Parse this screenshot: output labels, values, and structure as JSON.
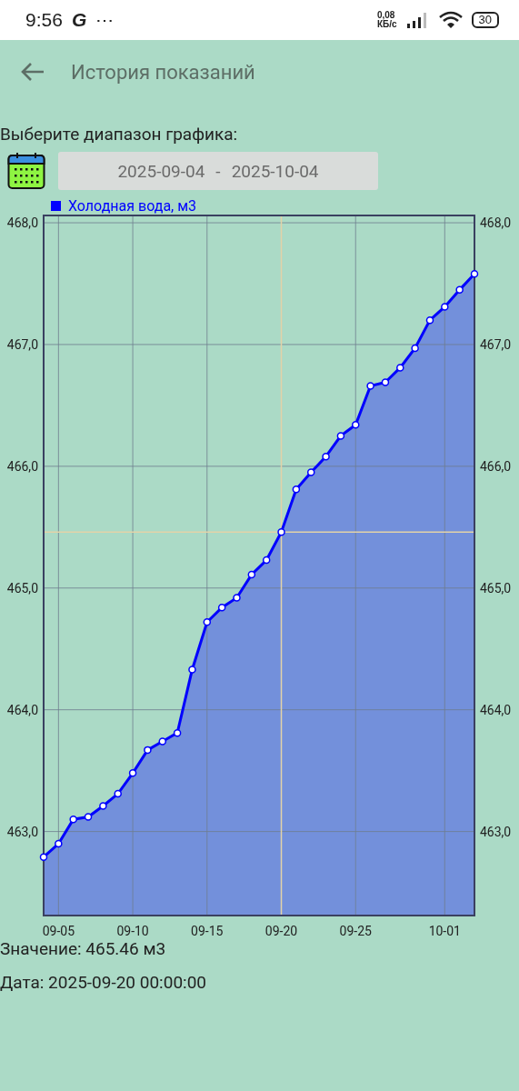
{
  "status_bar": {
    "time": "9:56",
    "carrier": "G",
    "more": "⋯",
    "speed_value": "0,08",
    "speed_unit": "КБ/с",
    "battery": "30"
  },
  "app_bar": {
    "title": "История показаний"
  },
  "range": {
    "label": "Выберите диапазон графика:",
    "start": "2025-09-04",
    "separator": "-",
    "end": "2025-10-04"
  },
  "chart": {
    "chart_data": {
      "type": "area",
      "categories": [
        null,
        "09-05",
        null,
        null,
        null,
        null,
        "09-10",
        null,
        null,
        null,
        null,
        "09-15",
        null,
        null,
        null,
        null,
        "09-20",
        null,
        null,
        null,
        null,
        "09-25",
        null,
        null,
        null,
        null,
        null,
        "10-01",
        null,
        null
      ],
      "grid": true,
      "series": [
        {
          "name": "Холодная вода, м3",
          "color": "#0000ff",
          "values": [
            462.79,
            462.9,
            463.1,
            463.12,
            463.21,
            463.31,
            463.48,
            463.67,
            463.74,
            463.81,
            464.33,
            464.72,
            464.84,
            464.92,
            465.11,
            465.23,
            465.46,
            465.81,
            465.95,
            466.08,
            466.25,
            466.34,
            466.66,
            466.69,
            466.81,
            466.97,
            467.2,
            467.31,
            467.45,
            467.58
          ]
        }
      ],
      "ylim": [
        462.31,
        468.06
      ],
      "yticks": [
        {
          "value": 463,
          "label": "463,0"
        },
        {
          "value": 464,
          "label": "464,0"
        },
        {
          "value": 465,
          "label": "465,0"
        },
        {
          "value": 466,
          "label": "466,0"
        },
        {
          "value": 467,
          "label": "467,0"
        },
        {
          "value": 468,
          "label": "468,0"
        }
      ],
      "ref_lines": [
        {
          "axis": "x",
          "value": "09-20"
        },
        {
          "axis": "y",
          "value": 465.46
        }
      ]
    }
  },
  "selection": {
    "value": "Значение: 465.46 м3",
    "date": "Дата: 2025-09-20 00:00:00"
  }
}
